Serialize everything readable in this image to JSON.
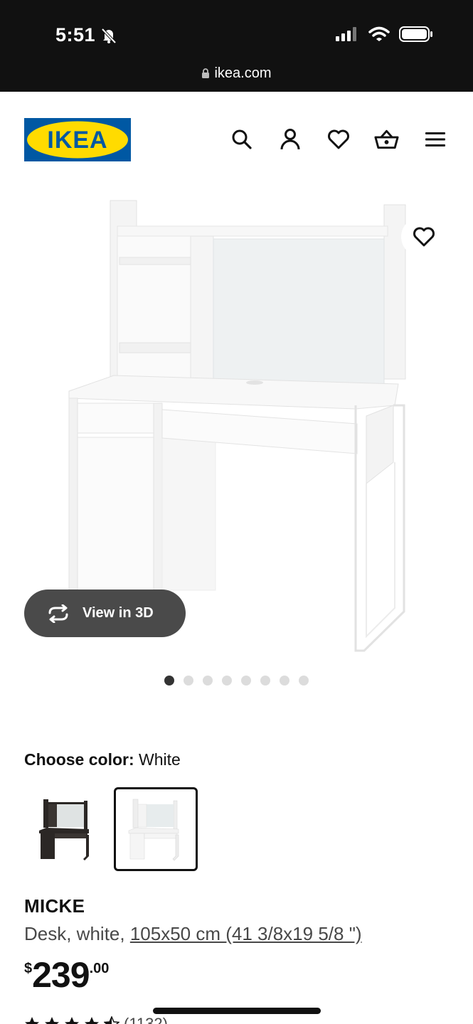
{
  "status_bar": {
    "time": "5:51"
  },
  "browser": {
    "url": "ikea.com"
  },
  "header": {
    "logo_text": "IKEA",
    "brand_colors": {
      "blue": "#0058A3",
      "yellow": "#FFDB00"
    },
    "icons": [
      "search-icon",
      "account-icon",
      "heart-icon",
      "basket-icon",
      "menu-icon"
    ]
  },
  "gallery": {
    "view_3d_label": "View in 3D",
    "dot_count": 8,
    "active_dot": 0
  },
  "color": {
    "label": "Choose color:",
    "value": "White",
    "options": [
      "black-brown",
      "white"
    ],
    "selected": 1
  },
  "product": {
    "name": "MICKE",
    "description_prefix": "Desk, white, ",
    "dimensions": "105x50 cm (41 3/8x19 5/8 \")",
    "price_currency": "$",
    "price_main": "239",
    "price_cents": ".00",
    "rating": 4.5,
    "review_count": "(1132)"
  }
}
